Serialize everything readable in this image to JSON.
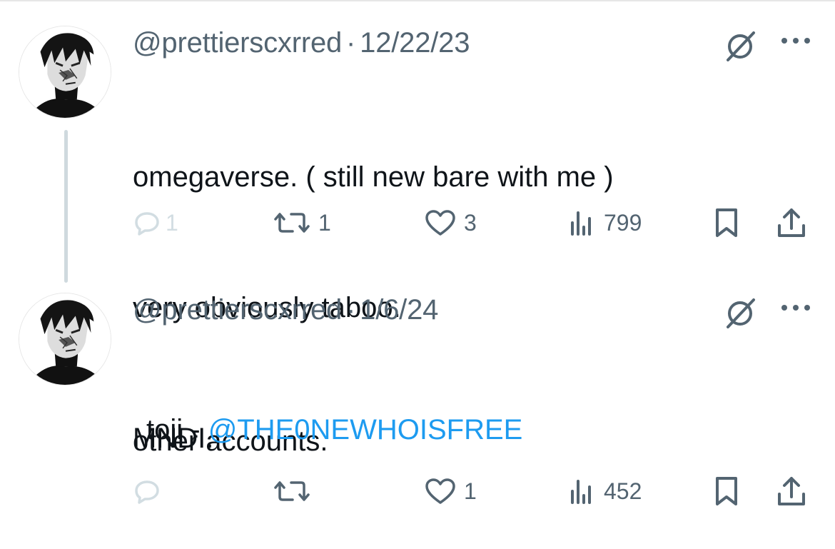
{
  "tweets": [
    {
      "handle": "@prettierscxrred",
      "separator": "·",
      "date": "12/22/23",
      "lines": [
        "omegaverse. ( still new bare with me )",
        "very obviously taboo.",
        "MNDI."
      ],
      "actions": {
        "replies": "1",
        "reposts": "1",
        "likes": "3",
        "views": "799"
      }
    },
    {
      "handle": "@prettierscxrred",
      "separator": "·",
      "date": "1/6/24",
      "lines": [
        "other accounts."
      ],
      "mention_prefix": "toji - ",
      "mention": "@THE0NEWHOISFREE",
      "actions": {
        "replies": "",
        "reposts": "",
        "likes": "1",
        "views": "452"
      }
    }
  ],
  "icons": {
    "avatar": "avatar-image",
    "grok": "grok-icon",
    "more": "more-icon",
    "reply": "reply-icon",
    "repost": "repost-icon",
    "like": "heart-icon",
    "views": "views-icon",
    "bookmark": "bookmark-icon",
    "share": "share-icon"
  },
  "colors": {
    "text": "#0f1419",
    "muted": "#536471",
    "link": "#1d9bf0",
    "thread_line": "#cfd9de"
  }
}
